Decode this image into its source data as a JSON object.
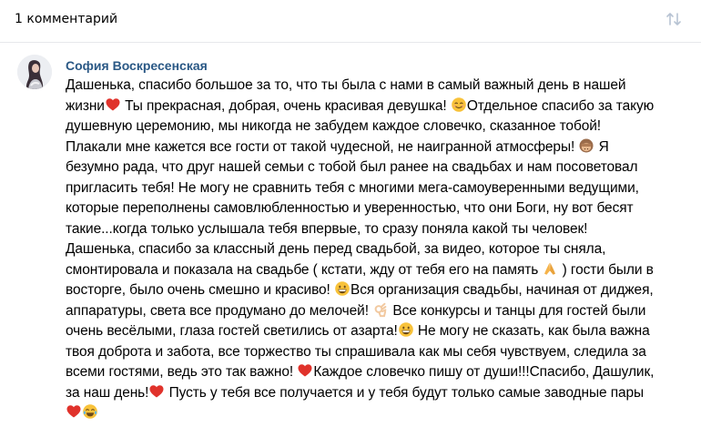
{
  "header": {
    "title": "1 комментарий"
  },
  "comment": {
    "author": "София Воскресенская",
    "lines": [
      {
        "text": "Дашенька, спасибо большое за то, что ты была с нами в самый важный день в нашей"
      },
      {
        "text": "жизни",
        "emoji": "heart",
        "after": " Ты прекрасная, добрая, очень красивая девушка! ",
        "emoji2": "smiling-face",
        "after2": "Отдельное спасибо за такую"
      },
      {
        "text": "душевную церемонию, мы никогда не забудем каждое словечко, сказанное тобой!"
      },
      {
        "text": "Плакали мне кажется все гости от такой чудесной, не наигранной атмосферы! ",
        "emoji": "see-no-evil-monkey",
        "after": " Я"
      },
      {
        "text": "безумно рада, что друг нашей семьи с тобой был ранее на свадьбах и нам посоветовал"
      },
      {
        "text": "пригласить тебя! Не могу не сравнить тебя с многими мега-самоуверенными ведущими,"
      },
      {
        "text": "которые переполнены самовлюбленностью и уверенностью, что они Боги, ну вот бесят"
      },
      {
        "text": "такие...когда только услышала тебя впервые, то сразу поняла какой ты человек!"
      },
      {
        "text": "Дашенька, спасибо за классный день перед свадьбой, за видео, которое ты сняла,"
      },
      {
        "text": "смонтировала и показала на свадьбе ( кстати, жду от тебя его на память ",
        "emoji": "folded-hands",
        "after": " ) гости были в"
      },
      {
        "text": "восторге, было очень смешно и красиво! ",
        "emoji": "grinning-face",
        "after": "Вся организация свадьбы, начиная от диджея,"
      },
      {
        "text": "аппаратуры, света все продумано до мелочей! ",
        "emoji": "ok-hand",
        "after": " Все конкурсы и танцы для гостей были"
      },
      {
        "text": "очень весёлыми, глаза гостей светились от азарта!",
        "emoji": "grinning-face",
        "after": " Не могу не сказать, как была важна"
      },
      {
        "text": "твоя доброта и забота, все торжество ты спрашивала как мы себя чувствуем, следила за"
      },
      {
        "text": "всеми гостями, ведь это так важно! ",
        "emoji": "heart",
        "after": "Каждое словечко пишу от души!!!Спасибо, Дашулик,"
      },
      {
        "text": "за наш день!",
        "emoji": "heart",
        "after": " Пусть у тебя все получается и у тебя будут только самые заводные пары"
      },
      {
        "text": "",
        "emoji": "heart",
        "emoji2": "tears-of-joy-face"
      }
    ]
  },
  "colors": {
    "author": "#2a5885",
    "text": "#000000",
    "divider": "#e7e8ec",
    "sort_icon": "#b7c3d3",
    "heart": "#e0322b",
    "emoji_face": "#f8c23a"
  }
}
